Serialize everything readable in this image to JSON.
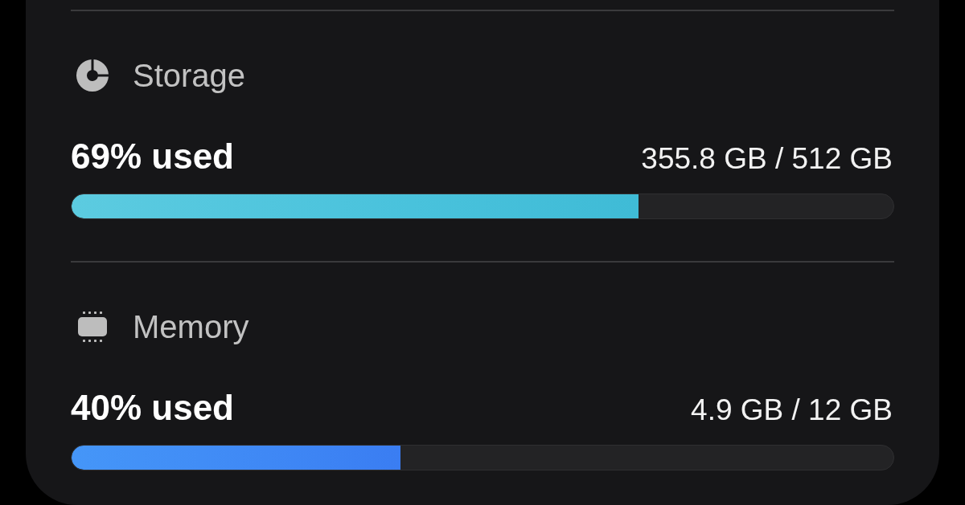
{
  "sections": [
    {
      "kind": "storage",
      "title": "Storage",
      "usage": "69% used",
      "amount": "355.8 GB / 512 GB",
      "level": 0.69
    },
    {
      "kind": "memory",
      "title": "Memory",
      "usage": "40% used",
      "amount": "4.9 GB / 12 GB",
      "level": 0.4
    }
  ]
}
